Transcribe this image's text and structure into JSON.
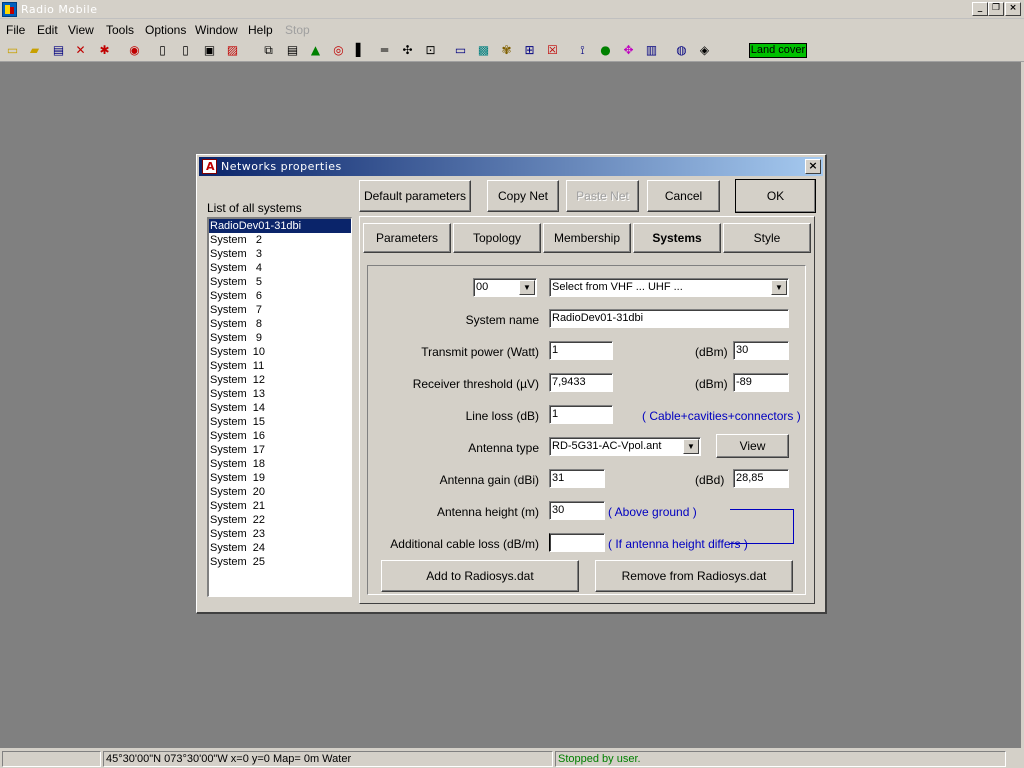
{
  "window": {
    "title": "Radio Mobile"
  },
  "menu": {
    "items": [
      "File",
      "Edit",
      "View",
      "Tools",
      "Options",
      "Window",
      "Help"
    ],
    "disabled_item": "Stop"
  },
  "toolbar": {
    "land_cover_label": "Land cover"
  },
  "dialog": {
    "title": "Networks properties",
    "buttons": {
      "default_parameters": "Default parameters",
      "copy_net": "Copy Net",
      "paste_net": "Paste Net",
      "cancel": "Cancel",
      "ok": "OK"
    },
    "list_label": "List of all systems",
    "systems": [
      "RadioDev01-31dbi",
      "System   2",
      "System   3",
      "System   4",
      "System   5",
      "System   6",
      "System   7",
      "System   8",
      "System   9",
      "System  10",
      "System  11",
      "System  12",
      "System  13",
      "System  14",
      "System  15",
      "System  16",
      "System  17",
      "System  18",
      "System  19",
      "System  20",
      "System  21",
      "System  22",
      "System  23",
      "System  24",
      "System  25"
    ],
    "selected_index": 0,
    "tabs": [
      "Parameters",
      "Topology",
      "Membership",
      "Systems",
      "Style"
    ],
    "active_tab": "Systems",
    "form": {
      "number_select": "00",
      "band_select": "Select from VHF ... UHF ...",
      "system_name_label": "System name",
      "system_name": "RadioDev01-31dbi",
      "transmit_power_label": "Transmit power (Watt)",
      "transmit_power": "1",
      "dbm_label": "(dBm)",
      "transmit_power_dbm": "30",
      "receiver_threshold_label": "Receiver threshold (µV)",
      "receiver_threshold": "7,9433",
      "receiver_threshold_dbm": "-89",
      "line_loss_label": "Line loss (dB)",
      "line_loss": "1",
      "line_loss_note": "( Cable+cavities+connectors )",
      "antenna_type_label": "Antenna type",
      "antenna_type": "RD-5G31-AC-Vpol.ant",
      "view_button": "View",
      "antenna_gain_label": "Antenna gain (dBi)",
      "antenna_gain": "31",
      "dbd_label": "(dBd)",
      "antenna_gain_dbd": "28,85",
      "antenna_height_label": "Antenna height (m)",
      "antenna_height": "30",
      "antenna_height_note": "( Above ground )",
      "additional_cable_loss_label": "Additional cable loss (dB/m)",
      "additional_cable_loss": "",
      "additional_cable_loss_note": "( If antenna height differs )",
      "add_button": "Add to Radiosys.dat",
      "remove_button": "Remove from Radiosys.dat"
    }
  },
  "status": {
    "coords": "45°30'00\"N  073°30'00\"W   x=0 y=0 Map= 0m Water",
    "message": "Stopped by user."
  }
}
